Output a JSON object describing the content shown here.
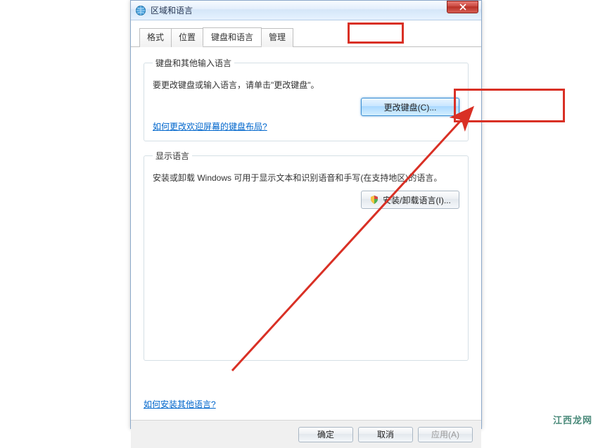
{
  "window": {
    "title": "区域和语言"
  },
  "tabs": [
    {
      "label": "格式"
    },
    {
      "label": "位置"
    },
    {
      "label": "键盘和语言",
      "active": true
    },
    {
      "label": "管理"
    }
  ],
  "groups": {
    "keyboard": {
      "legend": "键盘和其他输入语言",
      "desc": "要更改键盘或输入语言，请单击\"更改键盘\"。",
      "change_button": "更改键盘(C)...",
      "link": "如何更改欢迎屏幕的键盘布局?"
    },
    "display": {
      "legend": "显示语言",
      "desc": "安装或卸载 Windows 可用于显示文本和识别语音和手写(在支持地区)的语言。",
      "install_button": "安装/卸载语言(I)..."
    }
  },
  "bottom_link": "如何安装其他语言?",
  "footer": {
    "ok": "确定",
    "cancel": "取消",
    "apply": "应用(A)"
  },
  "watermark": "江西龙网"
}
